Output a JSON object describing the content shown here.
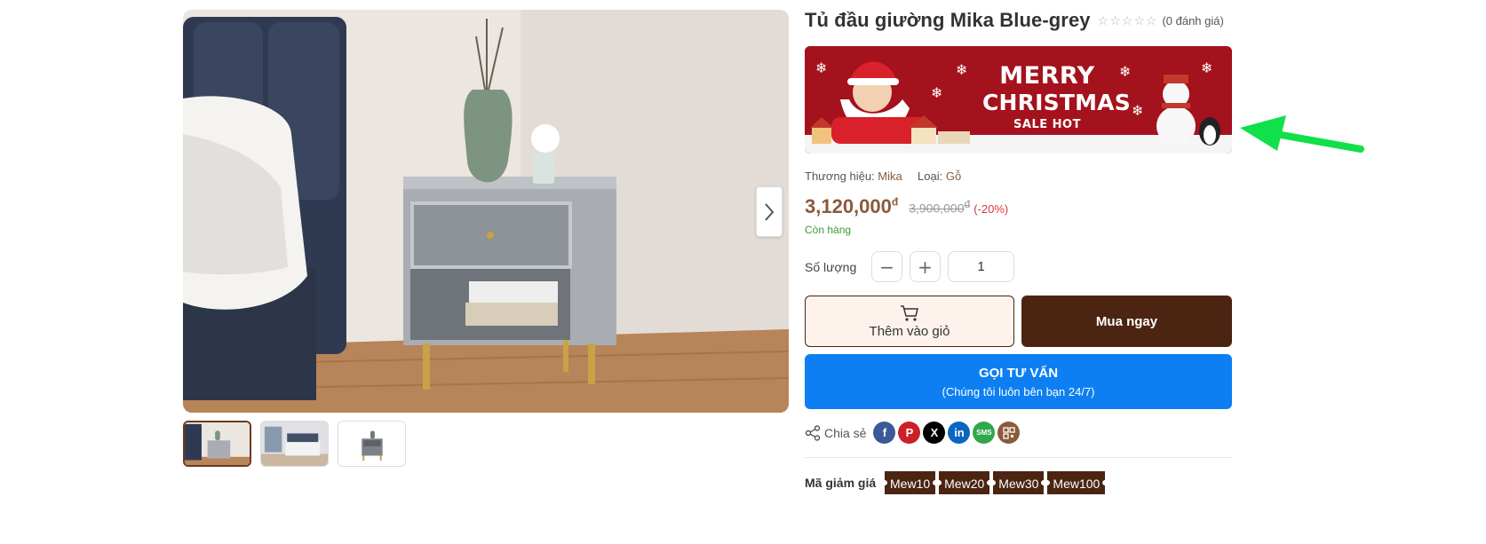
{
  "product": {
    "title": "Tủ đầu giường Mika Blue-grey",
    "rating_stars": 0,
    "review_count": "(0 đánh giá)",
    "brand_label": "Thương hiệu:",
    "brand_value": "Mika",
    "type_label": "Loại:",
    "type_value": "Gỗ",
    "price": "3,120,000",
    "price_currency": "đ",
    "old_price": "3,900,000",
    "old_price_currency": "đ",
    "discount": "(-20%)",
    "stock_status": "Còn hàng"
  },
  "banner": {
    "line1": "MERRY",
    "line2": "CHRISTMAS",
    "line3": "SALE HOT"
  },
  "quantity": {
    "label": "Số lượng",
    "minus": "−",
    "plus": "+",
    "value": "1"
  },
  "actions": {
    "add_to_cart": "Thêm vào giỏ",
    "buy_now": "Mua ngay",
    "consult_title": "GỌI TƯ VẤN",
    "consult_subtitle": "(Chúng tôi luôn bên bạn 24/7)"
  },
  "share": {
    "label": "Chia sẻ",
    "networks": [
      "facebook",
      "pinterest",
      "x",
      "linkedin",
      "sms",
      "qr-code"
    ]
  },
  "coupons": {
    "label": "Mã giảm giá",
    "codes": [
      "Mew10",
      "Mew20",
      "Mew30",
      "Mew100"
    ]
  },
  "colors": {
    "brown": "#4b2512",
    "price": "#8a5a3b",
    "consult_blue": "#0d7ff2",
    "stock_green": "#3a9a3a",
    "discount_red": "#d9363e",
    "pointer_arrow": "#11e04a"
  }
}
